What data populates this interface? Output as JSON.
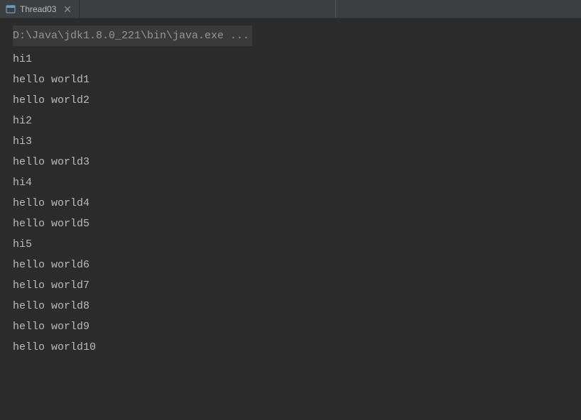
{
  "tab": {
    "label": "Thread03"
  },
  "console": {
    "command": "D:\\Java\\jdk1.8.0_221\\bin\\java.exe ...",
    "output": [
      "hi1",
      "hello world1",
      "hello world2",
      "hi2",
      "hi3",
      "hello world3",
      "hi4",
      "hello world4",
      "hello world5",
      "hi5",
      "hello world6",
      "hello world7",
      "hello world8",
      "hello world9",
      "hello world10"
    ]
  }
}
